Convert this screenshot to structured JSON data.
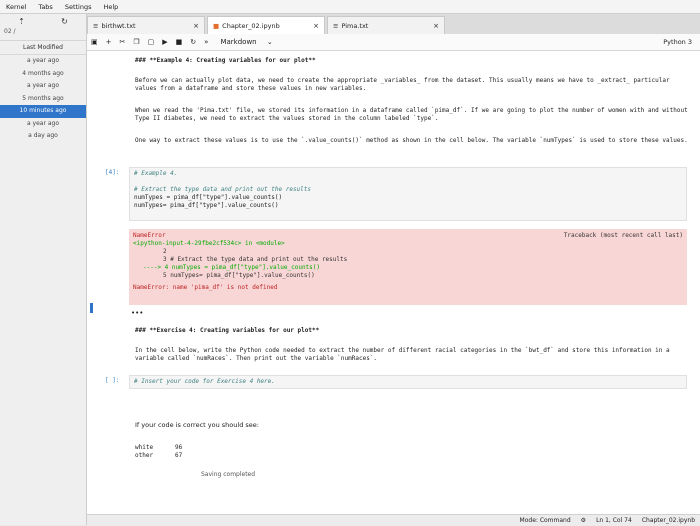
{
  "menu": [
    "Kernel",
    "Tabs",
    "Settings",
    "Help"
  ],
  "left_panel": {
    "path": "02 /",
    "column_header": "Last Modified",
    "rows": [
      "a year ago",
      "4 months ago",
      "a year ago",
      "5 months ago",
      "10 minutes ago",
      "a year ago",
      "a day ago"
    ],
    "selected_index": 4
  },
  "tabs": [
    {
      "name": "birthwt.txt",
      "active": false
    },
    {
      "name": "Chapter_02.ipynb",
      "active": true
    },
    {
      "name": "Pima.txt",
      "active": false
    }
  ],
  "toolbar": {
    "cell_type": "Markdown",
    "kernel": "Python 3"
  },
  "cells": {
    "ex4_heading": "### **Example 4: Creating variables for our plot**",
    "ex4_p1": "Before we can actually plot data, we need to create the appropriate _variables_ from the dataset. This usually means we have to _extract_ particular values from a dataframe and store these values in new variables.",
    "ex4_p2": "When we read the 'Pima.txt' file, we stored its information in a dataframe called `pima_df`. If we are going to plot the number of women with and without Type II diabetes, we need to extract the values stored in the column labeled `type`.",
    "ex4_p3": "One way to extract these values is to use the `.value_counts()` method as shown in the cell below. The variable `numTypes` is used to store these values.",
    "code_prompt": "[4]:",
    "code_lines": [
      "# Example 4.",
      "",
      "# Extract the type data and print out the results",
      "numTypes = pima_df[\"type\"].value_counts()",
      "numTypes= pima_df[\"type\"].value_counts()"
    ],
    "error": {
      "name": "NameError",
      "traceback_label": "Traceback (most recent call last)",
      "location": "<ipython-input-4-29fbe2cf534c> in <module>",
      "lines": [
        "2",
        "3 # Extract the type data and print out the results",
        "----> 4 numTypes = pima_df[\"type\"].value_counts()",
        "5 numTypes= pima_df[\"type\"].value_counts()"
      ],
      "message": "NameError: name 'pima_df' is not defined"
    },
    "ellipsis": "•••",
    "ex_heading": "### **Exercise 4: Creating variables for our plot**",
    "ex_p1": "In the cell below, write the Python code needed to extract the number of different racial categories in the `bwt_df` and store this information in a variable called `numRaces`. Then print out the variable `numRaces`.",
    "ex_prompt": "[ ]:",
    "ex_code": "# Insert your code for Exercise 4 here.",
    "correct_text": "If your code is correct you should see:",
    "result_rows": [
      {
        "label": "white",
        "value": "96"
      },
      {
        "label": "other",
        "value": "67"
      }
    ],
    "saving": "Saving completed"
  },
  "status": {
    "mode": "Mode: Command",
    "position": "Ln 1, Col 74",
    "file": "Chapter_02.ipynb"
  }
}
